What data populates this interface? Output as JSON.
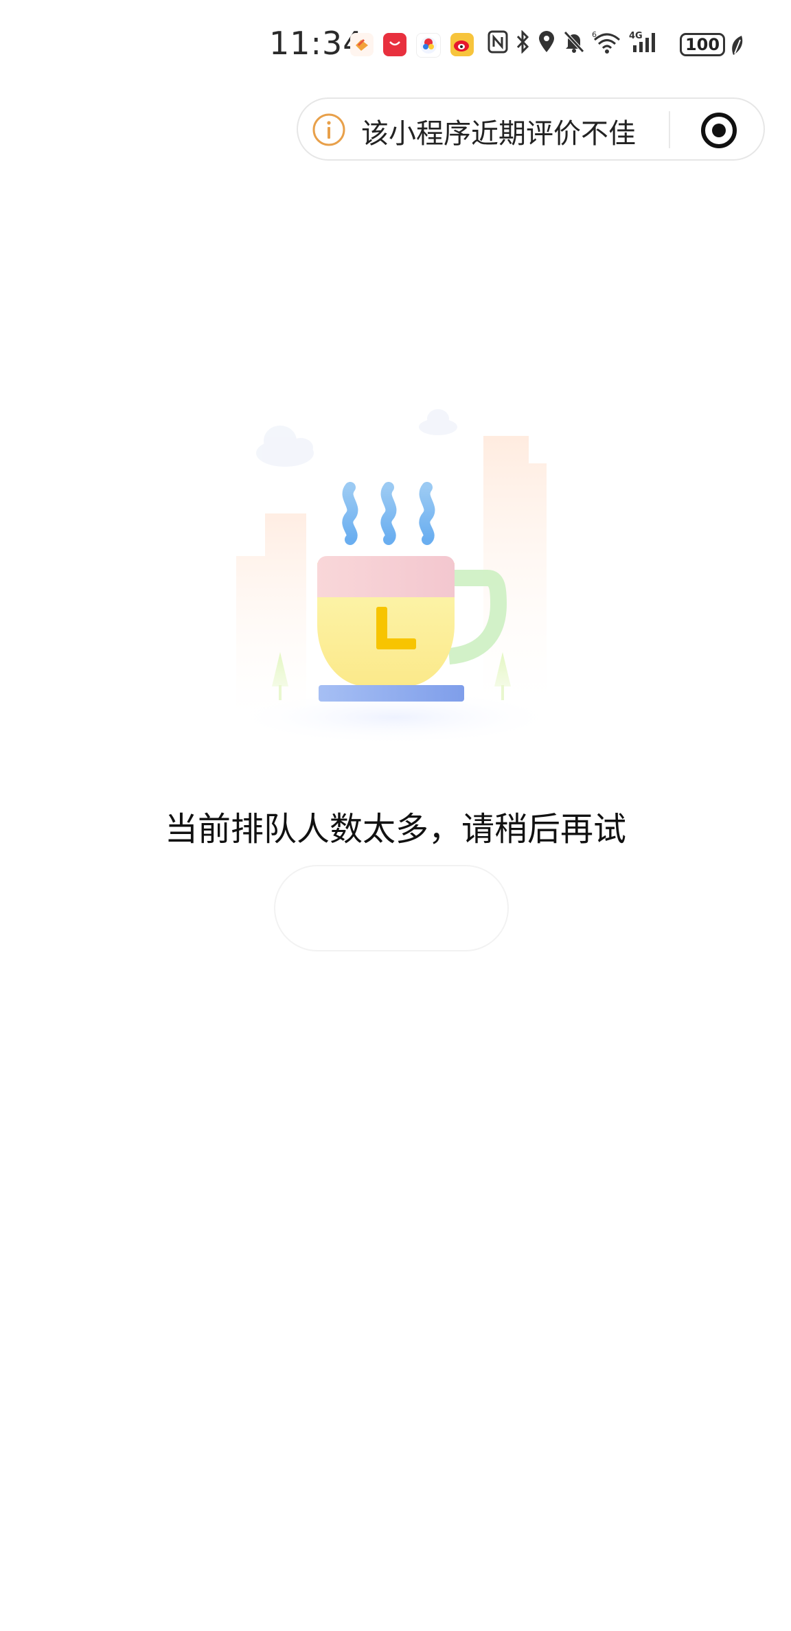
{
  "status_bar": {
    "time": "11:34",
    "battery": "100",
    "network_label": "4G",
    "notification_icons": [
      "health-app-icon",
      "huawei-store-icon",
      "game-app-icon",
      "weibo-icon"
    ],
    "system_icons": [
      "nfc-icon",
      "bluetooth-icon",
      "location-icon",
      "mute-icon",
      "wifi-icon",
      "signal-icon",
      "battery-icon",
      "leaf-icon"
    ]
  },
  "capsule": {
    "warning_text": "该小程序近期评价不佳",
    "info_icon": "info-icon",
    "close_icon": "close-miniprogram-icon"
  },
  "illustration": {
    "name": "coffee-cup-waiting-illustration"
  },
  "message": "当前排队人数太多，请稍后再试",
  "retry_button": {
    "label": ""
  },
  "colors": {
    "accent_warning": "#e8a04a",
    "cup_yellow": "#fdf0a0",
    "cup_pink": "#f6cdd3",
    "cup_handle": "#c8f0c0",
    "clock_hands": "#f5c400",
    "saucer_blue": "#8aa6ee",
    "steam_blue": "#7fb8f0"
  }
}
